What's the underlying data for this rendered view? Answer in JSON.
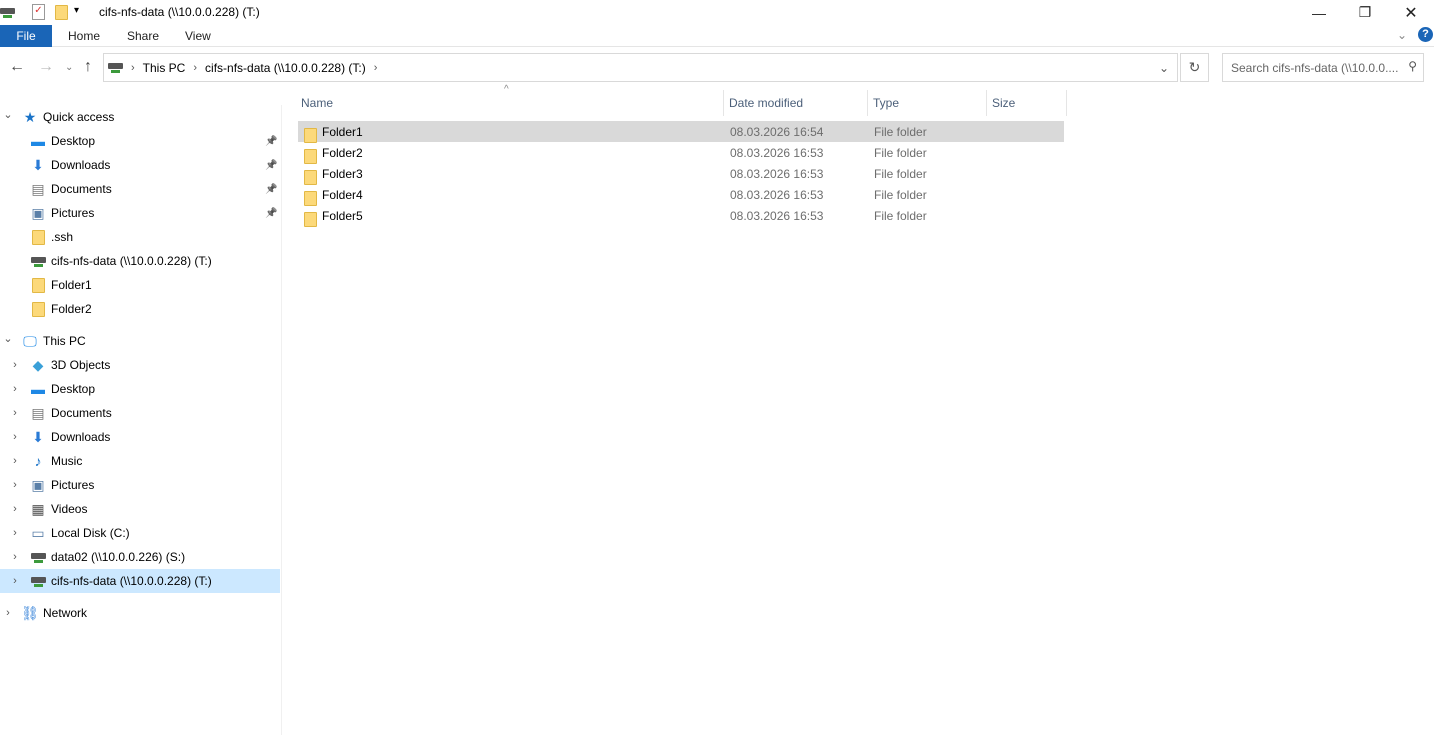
{
  "window": {
    "title": "cifs-nfs-data (\\\\10.0.0.228) (T:)"
  },
  "ribbon": {
    "tabs": [
      "File",
      "Home",
      "Share",
      "View"
    ]
  },
  "address": {
    "crumbs": [
      "This PC",
      "cifs-nfs-data (\\\\10.0.0.228) (T:)"
    ]
  },
  "search": {
    "placeholder": "Search cifs-nfs-data (\\\\10.0.0...."
  },
  "columns": {
    "name": "Name",
    "date": "Date modified",
    "type": "Type",
    "size": "Size"
  },
  "files": [
    {
      "name": "Folder1",
      "date": "08.03.2026 16:54",
      "type": "File folder",
      "selected": true
    },
    {
      "name": "Folder2",
      "date": "08.03.2026 16:53",
      "type": "File folder"
    },
    {
      "name": "Folder3",
      "date": "08.03.2026 16:53",
      "type": "File folder"
    },
    {
      "name": "Folder4",
      "date": "08.03.2026 16:53",
      "type": "File folder"
    },
    {
      "name": "Folder5",
      "date": "08.03.2026 16:53",
      "type": "File folder"
    }
  ],
  "sidebar": [
    {
      "label": "Quick access",
      "icon": "star",
      "level": 0,
      "chev": "open"
    },
    {
      "label": "Desktop",
      "icon": "desktop",
      "level": 1,
      "pin": true
    },
    {
      "label": "Downloads",
      "icon": "download",
      "level": 1,
      "pin": true
    },
    {
      "label": "Documents",
      "icon": "document",
      "level": 1,
      "pin": true
    },
    {
      "label": "Pictures",
      "icon": "picture",
      "level": 1,
      "pin": true
    },
    {
      "label": ".ssh",
      "icon": "folder",
      "level": 1
    },
    {
      "label": "cifs-nfs-data (\\\\10.0.0.228) (T:)",
      "icon": "drive",
      "level": 1
    },
    {
      "label": "Folder1",
      "icon": "folder",
      "level": 1
    },
    {
      "label": "Folder2",
      "icon": "folder",
      "level": 1
    },
    {
      "label": "This PC",
      "icon": "pc",
      "level": 0,
      "chev": "open",
      "gap": true
    },
    {
      "label": "3D Objects",
      "icon": "cube",
      "level": 1,
      "chev": "closed"
    },
    {
      "label": "Desktop",
      "icon": "desktop",
      "level": 1,
      "chev": "closed"
    },
    {
      "label": "Documents",
      "icon": "document",
      "level": 1,
      "chev": "closed"
    },
    {
      "label": "Downloads",
      "icon": "download",
      "level": 1,
      "chev": "closed"
    },
    {
      "label": "Music",
      "icon": "music",
      "level": 1,
      "chev": "closed"
    },
    {
      "label": "Pictures",
      "icon": "picture",
      "level": 1,
      "chev": "closed"
    },
    {
      "label": "Videos",
      "icon": "video",
      "level": 1,
      "chev": "closed"
    },
    {
      "label": "Local Disk (C:)",
      "icon": "disk",
      "level": 1,
      "chev": "closed"
    },
    {
      "label": "data02 (\\\\10.0.0.226) (S:)",
      "icon": "drive",
      "level": 1,
      "chev": "closed"
    },
    {
      "label": "cifs-nfs-data (\\\\10.0.0.228) (T:)",
      "icon": "drive",
      "level": 1,
      "chev": "closed",
      "selected": true
    },
    {
      "label": "Network",
      "icon": "network",
      "level": 0,
      "chev": "closed",
      "gap": true
    }
  ]
}
